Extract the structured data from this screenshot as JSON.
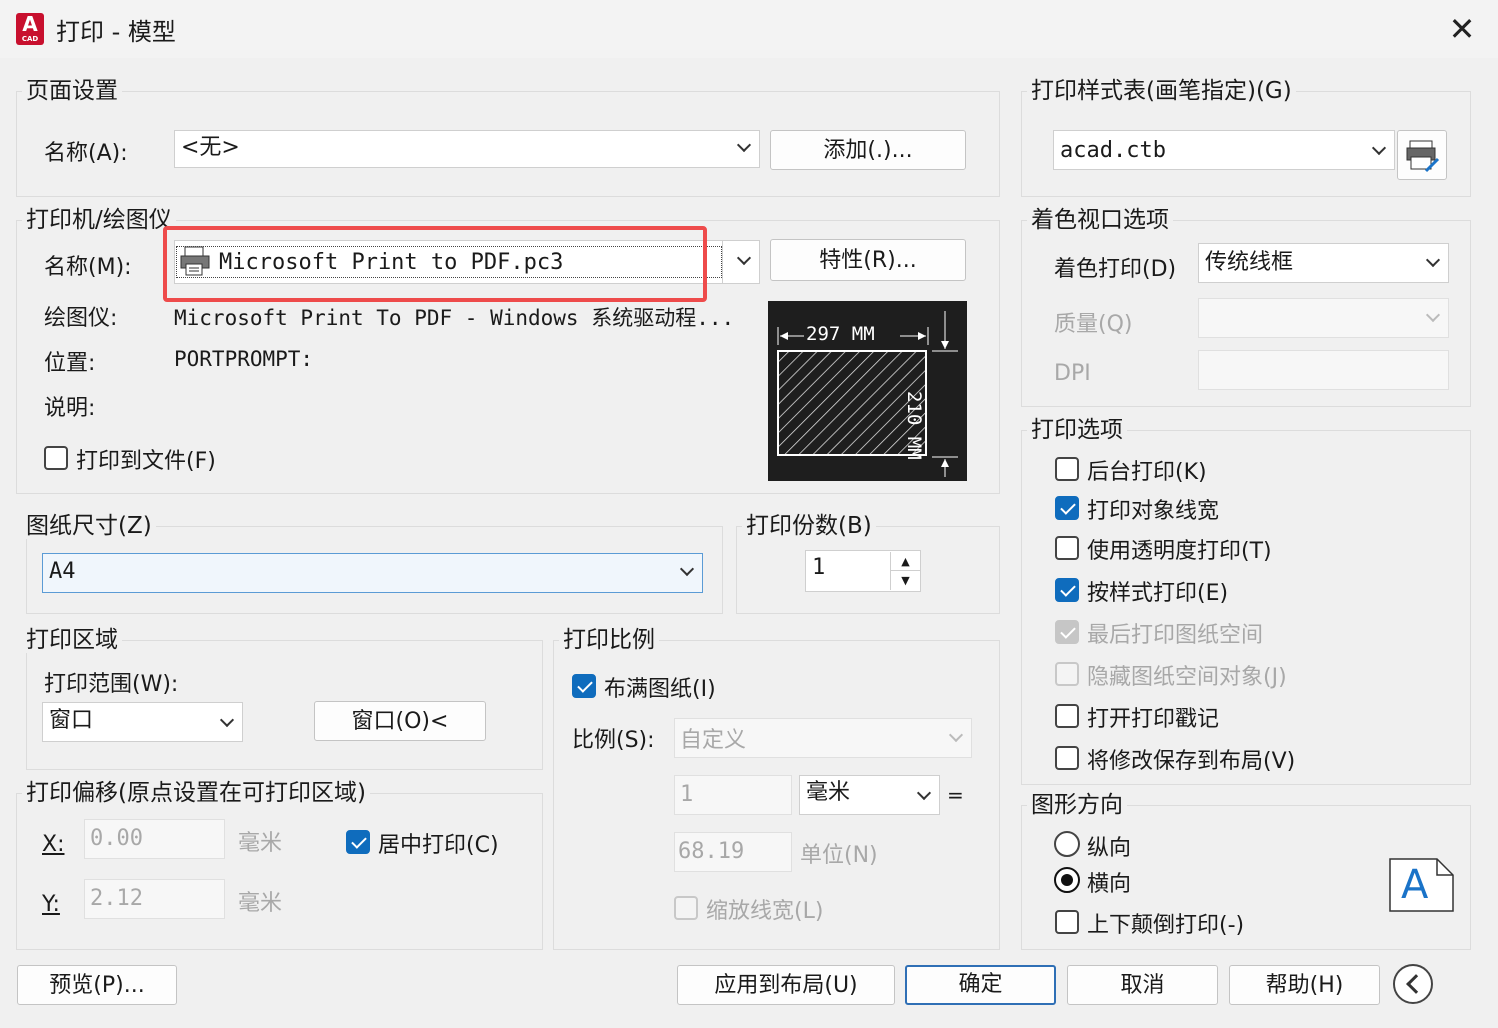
{
  "window": {
    "title": "打印 - 模型",
    "app_icon_letter": "A",
    "app_icon_sub": "CAD"
  },
  "page_setup": {
    "group_title": "页面设置",
    "name_label": "名称(A):",
    "name_value": "<无>",
    "add_button": "添加(.)..."
  },
  "printer": {
    "group_title": "打印机/绘图仪",
    "name_label": "名称(M):",
    "name_value": "Microsoft Print to PDF.pc3",
    "properties_button": "特性(R)...",
    "plotter_label": "绘图仪:",
    "plotter_value": "Microsoft Print To PDF - Windows 系统驱动程...",
    "location_label": "位置:",
    "location_value": "PORTPROMPT:",
    "description_label": "说明:",
    "print_to_file_label": "打印到文件(F)",
    "print_to_file_checked": false,
    "highlight_color": "#ee4b4b"
  },
  "paper_preview": {
    "width_text": "297 MM",
    "height_text": "210 MM"
  },
  "paper_size": {
    "group_title": "图纸尺寸(Z)",
    "value": "A4"
  },
  "copies": {
    "group_title": "打印份数(B)",
    "value": "1"
  },
  "plot_area": {
    "group_title": "打印区域",
    "range_label": "打印范围(W):",
    "range_value": "窗口",
    "window_button": "窗口(O)<"
  },
  "plot_offset": {
    "group_title": "打印偏移(原点设置在可打印区域)",
    "x_label": "X:",
    "x_value": "0.00",
    "x_unit": "毫米",
    "y_label": "Y:",
    "y_value": "2.12",
    "y_unit": "毫米",
    "center_label": "居中打印(C)",
    "center_checked": true
  },
  "plot_scale": {
    "group_title": "打印比例",
    "fit_label": "布满图纸(I)",
    "fit_checked": true,
    "scale_label": "比例(S):",
    "scale_value": "自定义",
    "value1": "1",
    "unit_value": "毫米",
    "equals": "=",
    "value2": "68.19",
    "unit2_label": "单位(N)",
    "lineweight_label": "缩放线宽(L)",
    "lineweight_checked": false
  },
  "plot_style_table": {
    "group_title": "打印样式表(画笔指定)(G)",
    "value": "acad.ctb"
  },
  "shaded_viewport": {
    "group_title": "着色视口选项",
    "shade_label": "着色打印(D)",
    "shade_value": "传统线框",
    "quality_label": "质量(Q)",
    "quality_value": "",
    "dpi_label": "DPI",
    "dpi_value": ""
  },
  "plot_options": {
    "group_title": "打印选项",
    "items": [
      {
        "label": "后台打印(K)",
        "checked": false,
        "disabled": false
      },
      {
        "label": "打印对象线宽",
        "checked": true,
        "disabled": false
      },
      {
        "label": "使用透明度打印(T)",
        "checked": false,
        "disabled": false
      },
      {
        "label": "按样式打印(E)",
        "checked": true,
        "disabled": false
      },
      {
        "label": "最后打印图纸空间",
        "checked": true,
        "disabled": true
      },
      {
        "label": "隐藏图纸空间对象(J)",
        "checked": false,
        "disabled": true
      },
      {
        "label": "打开打印戳记",
        "checked": false,
        "disabled": false
      },
      {
        "label": "将修改保存到布局(V)",
        "checked": false,
        "disabled": false
      }
    ]
  },
  "orientation": {
    "group_title": "图形方向",
    "portrait_label": "纵向",
    "landscape_label": "横向",
    "selected": "landscape",
    "upside_down_label": "上下颠倒打印(-)",
    "upside_down_checked": false,
    "preview_letter": "A"
  },
  "footer": {
    "preview_button": "预览(P)...",
    "apply_button": "应用到布局(U)",
    "ok_button": "确定",
    "cancel_button": "取消",
    "help_button": "帮助(H)"
  },
  "colors": {
    "accent": "#0f6cbd",
    "highlight": "#ee4b4b"
  }
}
